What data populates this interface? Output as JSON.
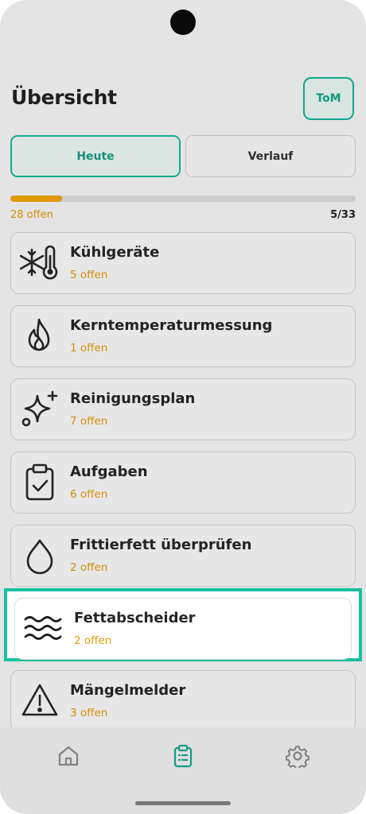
{
  "header": {
    "title": "Übersicht",
    "user_initials": "ToM"
  },
  "tabs": [
    {
      "label": "Heute",
      "active": true
    },
    {
      "label": "Verlauf",
      "active": false
    }
  ],
  "progress": {
    "open_label": "28 offen",
    "ratio_label": "5/33",
    "fraction": 0.15,
    "color": "#f2a50a"
  },
  "categories": [
    {
      "name": "Kühlgeräte",
      "open": "5 offen",
      "icon": "snowflake-thermometer-icon"
    },
    {
      "name": "Kerntemperaturmessung",
      "open": "1 offen",
      "icon": "flame-icon"
    },
    {
      "name": "Reinigungsplan",
      "open": "7 offen",
      "icon": "sparkles-icon"
    },
    {
      "name": "Aufgaben",
      "open": "6 offen",
      "icon": "clipboard-check-icon"
    },
    {
      "name": "Frittierfett überprüfen",
      "open": "2 offen",
      "icon": "droplet-icon"
    },
    {
      "name": "Fettabscheider",
      "open": "2 offen",
      "icon": "waves-icon",
      "highlighted": true
    },
    {
      "name": "Mängelmelder",
      "open": "3 offen",
      "icon": "warning-triangle-icon"
    }
  ],
  "bottom_nav": [
    {
      "icon": "home-icon",
      "active": false
    },
    {
      "icon": "clipboard-list-icon",
      "active": true
    },
    {
      "icon": "settings-gear-icon",
      "active": false
    }
  ],
  "colors": {
    "accent": "#17c19d",
    "warning_text": "#e69c08"
  }
}
